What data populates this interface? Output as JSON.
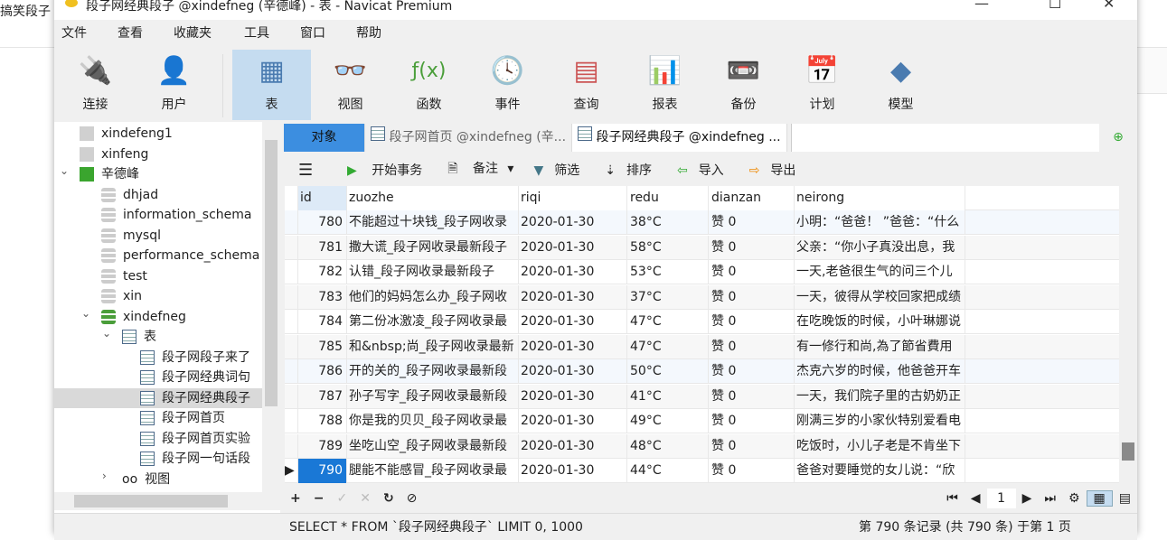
{
  "background": {
    "text": "搞笑段子"
  },
  "window": {
    "title": "段子网经典段子 @xindefneg (辛德峰) - 表 - Navicat Premium",
    "controls": [
      "—",
      "☐",
      "✕"
    ]
  },
  "menu": [
    "文件",
    "查看",
    "收藏夹",
    "工具",
    "窗口",
    "帮助"
  ],
  "toolbar": [
    {
      "label": "连接",
      "icon": "🔌"
    },
    {
      "label": "用户",
      "icon": "👤"
    },
    {
      "label": "表",
      "icon": "▦"
    },
    {
      "label": "视图",
      "icon": "👓"
    },
    {
      "label": "函数",
      "icon": "ƒ(x)"
    },
    {
      "label": "事件",
      "icon": "🕓"
    },
    {
      "label": "查询",
      "icon": "▤"
    },
    {
      "label": "报表",
      "icon": "📊"
    },
    {
      "label": "备份",
      "icon": "📼"
    },
    {
      "label": "计划",
      "icon": "📅"
    },
    {
      "label": "模型",
      "icon": "◆"
    }
  ],
  "tree": [
    {
      "label": "xindefeng1",
      "type": "conn"
    },
    {
      "label": "xinfeng",
      "type": "conn"
    },
    {
      "label": "辛德峰",
      "type": "conn-open"
    },
    {
      "label": "dhjad",
      "type": "db"
    },
    {
      "label": "information_schema",
      "type": "db"
    },
    {
      "label": "mysql",
      "type": "db"
    },
    {
      "label": "performance_schema",
      "type": "db"
    },
    {
      "label": "test",
      "type": "db"
    },
    {
      "label": "xin",
      "type": "db"
    },
    {
      "label": "xindefneg",
      "type": "db-open"
    },
    {
      "label": "表",
      "type": "folder"
    },
    {
      "label": "段子网段子来了",
      "type": "table"
    },
    {
      "label": "段子网经典词句",
      "type": "table"
    },
    {
      "label": "段子网经典段子",
      "type": "table",
      "selected": true
    },
    {
      "label": "段子网首页",
      "type": "table"
    },
    {
      "label": "段子网首页实验",
      "type": "table"
    },
    {
      "label": "段子网一句话段",
      "type": "table"
    },
    {
      "label": "视图",
      "type": "views"
    }
  ],
  "tabs": {
    "objects": "对象",
    "tab1": "段子网首页 @xindefneg (辛...",
    "tab2": "段子网经典段子 @xindefneg ..."
  },
  "subtoolbar": {
    "menu": "☰",
    "begin": "开始事务",
    "note": "备注",
    "filter": "筛选",
    "sort": "排序",
    "import": "导入",
    "export": "导出"
  },
  "columns": [
    "id",
    "zuozhe",
    "riqi",
    "redu",
    "dianzan",
    "neirong"
  ],
  "rows": [
    [
      "780",
      "不能超过十块钱_段子网收录",
      "2020-01-30",
      "38°C",
      "赞 0",
      "小明：“爸爸！ ”爸爸：“什么"
    ],
    [
      "781",
      "撒大谎_段子网收录最新段子",
      "2020-01-30",
      "58°C",
      "赞 0",
      "父亲：“你小子真没出息，我"
    ],
    [
      "782",
      "认错_段子网收录最新段子",
      "2020-01-30",
      "53°C",
      "赞 0",
      "一天,老爸很生气的问三个儿"
    ],
    [
      "783",
      "他们的妈妈怎么办_段子网收",
      "2020-01-30",
      "37°C",
      "赞 0",
      "一天，彼得从学校回家把成绩"
    ],
    [
      "784",
      "第二份冰激凌_段子网收录最",
      "2020-01-30",
      "47°C",
      "赞 0",
      "在吃晚饭的时候，小叶琳娜说"
    ],
    [
      "785",
      "和&nbsp;尚_段子网收录最新",
      "2020-01-30",
      "47°C",
      "赞 0",
      "有一修行和尚,為了節省費用"
    ],
    [
      "786",
      "开的关的_段子网收录最新段",
      "2020-01-30",
      "50°C",
      "赞 0",
      "杰克六岁的时候，他爸爸开车"
    ],
    [
      "787",
      "孙子写字_段子网收录最新段",
      "2020-01-30",
      "41°C",
      "赞 0",
      "一天，我们院子里的古奶奶正"
    ],
    [
      "788",
      "你是我的贝贝_段子网收录最",
      "2020-01-30",
      "49°C",
      "赞 0",
      "刚满三岁的小家伙特别爱看电"
    ],
    [
      "789",
      "坐吃山空_段子网收录最新段",
      "2020-01-30",
      "48°C",
      "赞 0",
      "吃饭时，小儿子老是不肯坐下"
    ],
    [
      "790",
      "腿能不能感冒_段子网收录最",
      "2020-01-30",
      "44°C",
      "赞 0",
      "爸爸对要睡觉的女儿说：“欣"
    ]
  ],
  "bottom": {
    "add": "+",
    "remove": "−",
    "apply": "✓",
    "cancel": "✕",
    "refresh": "↻",
    "stop": "⊘",
    "first": "⏮",
    "prev": "◀",
    "page": "1",
    "next": "▶",
    "last": "⏭",
    "settings": "⚙"
  },
  "status": {
    "sql": "SELECT * FROM `段子网经典段子` LIMIT 0, 1000",
    "records": "第 790 条记录 (共 790 条) 于第 1 页"
  }
}
